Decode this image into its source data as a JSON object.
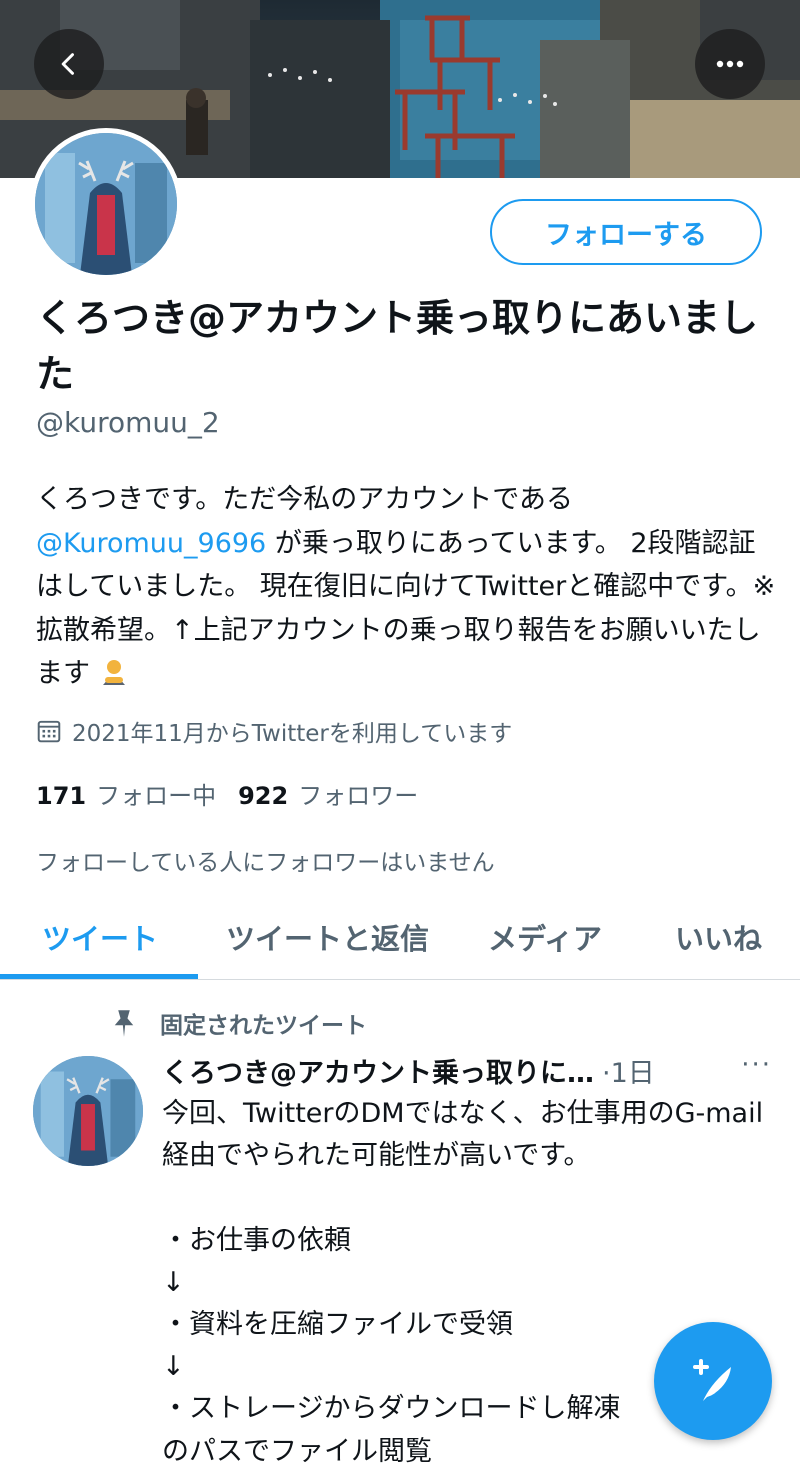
{
  "header": {
    "back_icon": "chevron-left-icon",
    "more_icon": "ellipsis-icon"
  },
  "profile": {
    "follow_label": "フォローする",
    "display_name": "くろつき@アカウント乗っ取りにあいました",
    "handle": "@kuromuu_2",
    "bio": {
      "line1": "くろつきです。ただ今私のアカウントである",
      "mention": "@Kuromuu_9696",
      "rest": " が乗っ取りにあっています。 2段階認証はしていました。 現在復旧に向けてTwitterと確認中です。※拡散希望。↑上記アカウントの乗っ取り報告をお願いいたします"
    },
    "joined": "2021年11月からTwitterを利用しています",
    "following_count": "171",
    "following_label": "フォロー中",
    "followers_count": "922",
    "followers_label": "フォロワー",
    "no_known_followers": "フォローしている人にフォロワーはいません"
  },
  "tabs": [
    {
      "label": "ツイート",
      "active": true
    },
    {
      "label": "ツイートと返信",
      "active": false
    },
    {
      "label": "メディア",
      "active": false
    },
    {
      "label": "いいね",
      "active": false
    }
  ],
  "pinned_tweet": {
    "pinned_label": "固定されたツイート",
    "author": "くろつき@アカウント乗っ取りに…",
    "time": "·1日",
    "more": "···",
    "text": "今回、TwitterのDMではなく、お仕事用のG-mail経由でやられた可能性が高いです。\n\n・お仕事の依頼\n↓\n・資料を圧縮ファイルで受領\n↓\n・ストレージからダウンロードし解凍\nのパスでファイル閲覧"
  },
  "colors": {
    "accent": "#1d9bf0",
    "secondary_text": "#536471",
    "primary_text": "#0f1419"
  }
}
